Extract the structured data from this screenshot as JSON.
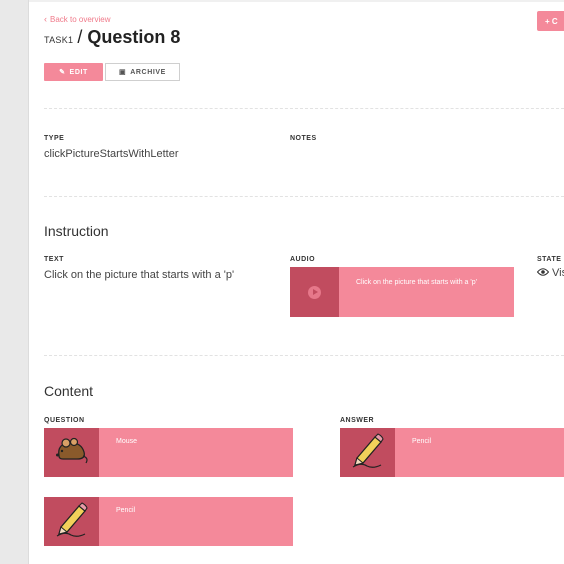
{
  "nav": {
    "back_label": "Back to overview",
    "top_action_label": "+ C"
  },
  "header": {
    "task_label": "TASK1",
    "separator": "/",
    "title": "Question 8"
  },
  "actions": {
    "edit_label": "EDIT",
    "archive_label": "ARCHIVE"
  },
  "details": {
    "type_label": "TYPE",
    "type_value": "clickPictureStartsWithLetter",
    "notes_label": "NOTES"
  },
  "instruction": {
    "heading": "Instruction",
    "text_label": "TEXT",
    "text_value": "Click on the picture that starts with a 'p'",
    "audio_label": "AUDIO",
    "audio_caption": "Click on the picture that starts with a 'p'",
    "state_label": "STATE",
    "state_value": "Vis"
  },
  "content": {
    "heading": "Content",
    "question_label": "QUESTION",
    "answer_label": "ANSWER",
    "questions": [
      {
        "name": "Mouse",
        "icon": "mouse-icon"
      },
      {
        "name": "Pencil",
        "icon": "pencil-icon"
      }
    ],
    "answers": [
      {
        "name": "Pencil",
        "icon": "pencil-icon"
      }
    ]
  },
  "colors": {
    "accent": "#f4899a",
    "accent_dark": "#c14c5f"
  }
}
